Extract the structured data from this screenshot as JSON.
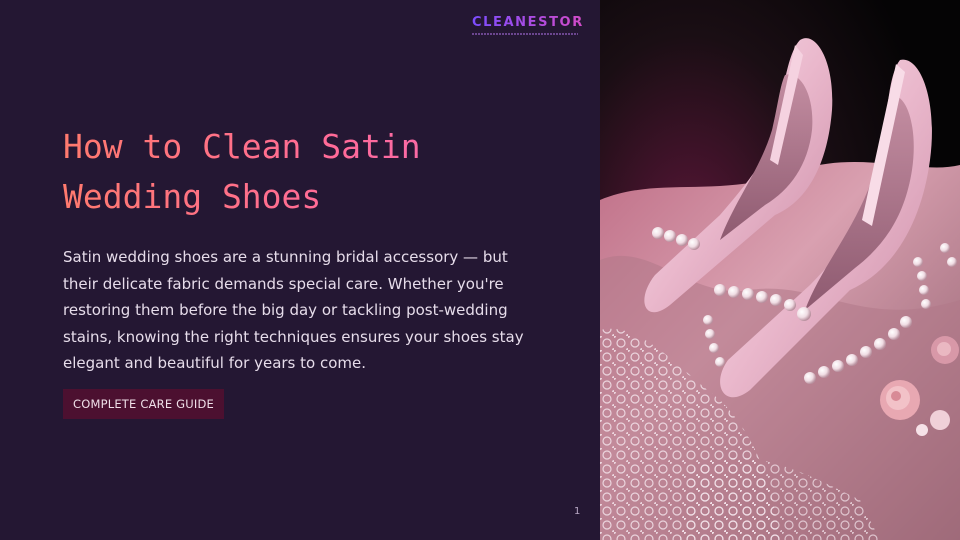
{
  "brand": {
    "name": "CLEANESTOR"
  },
  "title": "How to Clean Satin Wedding Shoes",
  "body": "Satin wedding shoes are a stunning bridal accessory — but their delicate fabric demands special care. Whether you're restoring them before the big day or tackling post-wedding stains, knowing the right techniques ensures your shoes stay elegant and beautiful for years to come.",
  "cta": "COMPLETE CARE GUIDE",
  "page_number": "1",
  "colors": {
    "background": "#241733",
    "title_start": "#ff7a6e",
    "title_end": "#f26bb5",
    "button": "#4c1030"
  },
  "image": {
    "subject": "pink satin pointed-toe high heels with pearl strands on pink fabric and lace"
  }
}
